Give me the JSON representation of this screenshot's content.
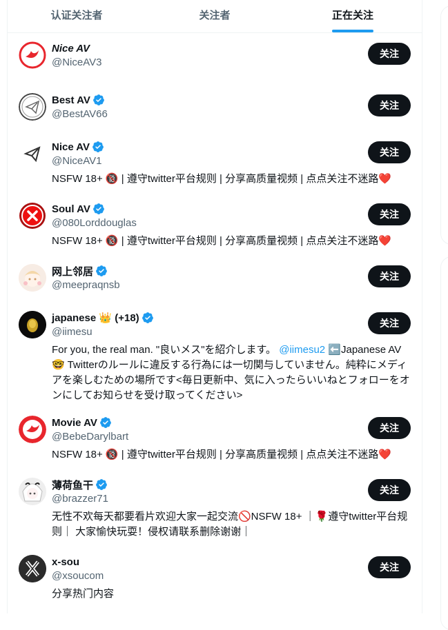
{
  "tabs": [
    {
      "label": "认证关注者"
    },
    {
      "label": "关注者"
    },
    {
      "label": "正在关注"
    }
  ],
  "follow_label": "关注",
  "users": [
    {
      "name": "Nice AV",
      "handle": "@NiceAV3",
      "verified": false,
      "bio": ""
    },
    {
      "name": "Best AV",
      "handle": "@BestAV66",
      "verified": true,
      "bio": ""
    },
    {
      "name": "Nice AV",
      "handle": "@NiceAV1",
      "verified": true,
      "bio": "NSFW 18+ 🔞 | 遵守twitter平台规则 | 分享高质量视频 | 点点关注不迷路❤️"
    },
    {
      "name": "Soul AV",
      "handle": "@080Lorddouglas",
      "verified": true,
      "bio": "NSFW 18+ 🔞 | 遵守twitter平台规则 | 分享高质量视频 | 点点关注不迷路❤️"
    },
    {
      "name": "网上邻居",
      "handle": "@meepraqnsb",
      "verified": true,
      "bio": ""
    },
    {
      "name": "japanese 👑 (+18)",
      "handle": "@iimesu",
      "verified": true,
      "bio_pre": "For you, the real man. \"良いメス\"を紹介します。 ",
      "bio_link": "@iimesu2",
      "bio_post": " ⬅️Japanese AV 🤓 Twitterのルールに違反する行為には一切関与していません。純粋にメディアを楽しむための場所です<毎日更新中、気に入ったらいいねとフォローをオンにしてお知らせを受け取ってください>"
    },
    {
      "name": "Movie AV",
      "handle": "@BebeDarylbart",
      "verified": true,
      "bio": "NSFW 18+ 🔞 | 遵守twitter平台规则 | 分享高质量视频 | 点点关注不迷路❤️"
    },
    {
      "name": "薄荷鱼干",
      "handle": "@brazzer71",
      "verified": true,
      "bio": "无性不欢每天都要看片欢迎大家一起交流🚫NSFW 18+ ｜🌹遵守twitter平台规则｜ 大家愉快玩耍！侵权请联系删除谢谢｜"
    },
    {
      "name": "x-sou",
      "handle": "@xsoucom",
      "verified": false,
      "bio": "分享热门内容"
    }
  ],
  "colors": {
    "accent": "#1d9bf0",
    "text": "#0f1419",
    "muted": "#536471",
    "button_bg": "#0f1419"
  }
}
